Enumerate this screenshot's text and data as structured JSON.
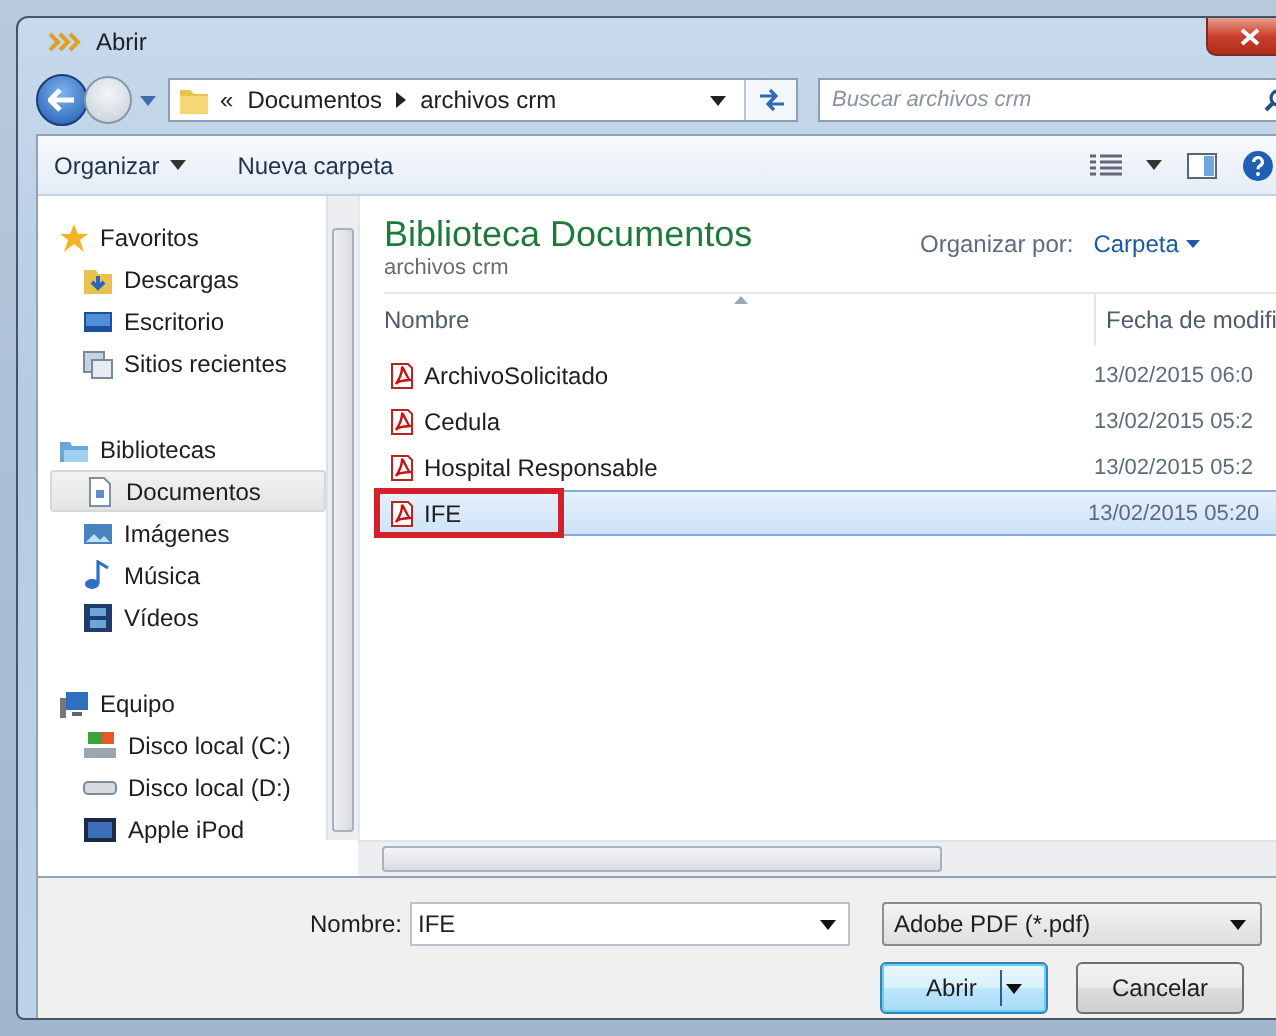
{
  "window": {
    "title": "Abrir"
  },
  "address": {
    "crumbs": [
      "«",
      "Documentos",
      "archivos crm"
    ]
  },
  "search": {
    "placeholder": "Buscar archivos crm"
  },
  "toolbar": {
    "items": [
      "Organizar",
      "Nueva carpeta"
    ]
  },
  "sidebar": {
    "groups": [
      {
        "label": "Favoritos",
        "selected": false,
        "children": [
          {
            "label": "Descargas",
            "selected": false
          },
          {
            "label": "Escritorio",
            "selected": false
          },
          {
            "label": "Sitios recientes",
            "selected": false
          }
        ]
      },
      {
        "label": "Bibliotecas",
        "selected": false,
        "children": [
          {
            "label": "Documentos",
            "selected": true
          },
          {
            "label": "Imágenes",
            "selected": false
          },
          {
            "label": "Música",
            "selected": false
          },
          {
            "label": "Vídeos",
            "selected": false
          }
        ]
      },
      {
        "label": "Equipo",
        "selected": false,
        "children": [
          {
            "label": "Disco local (C:)",
            "selected": false
          },
          {
            "label": "Disco local (D:)",
            "selected": false
          },
          {
            "label": "Apple iPod",
            "selected": false
          }
        ]
      }
    ]
  },
  "library": {
    "title": "Biblioteca Documentos",
    "subtitle": "archivos crm",
    "arrange_label": "Organizar por:",
    "arrange_value": "Carpeta"
  },
  "table": {
    "columns": [
      "Nombre",
      "Fecha de modifi"
    ],
    "rows": [
      {
        "name": "ArchivoSolicitado",
        "date": "13/02/2015 06:0",
        "selected": false,
        "annotated": false
      },
      {
        "name": "Cedula",
        "date": "13/02/2015 05:2",
        "selected": false,
        "annotated": false
      },
      {
        "name": "Hospital Responsable",
        "date": "13/02/2015 05:2",
        "selected": false,
        "annotated": false
      },
      {
        "name": "IFE",
        "date": "13/02/2015 05:20",
        "selected": true,
        "annotated": true
      }
    ]
  },
  "filename": {
    "label": "Nombre:",
    "value": "IFE"
  },
  "filter": {
    "value": "Adobe PDF (*.pdf)"
  },
  "buttons": [
    {
      "label": "Abrir",
      "kind": "split",
      "default": true
    },
    {
      "label": "Cancelar",
      "kind": "plain",
      "default": false
    }
  ]
}
